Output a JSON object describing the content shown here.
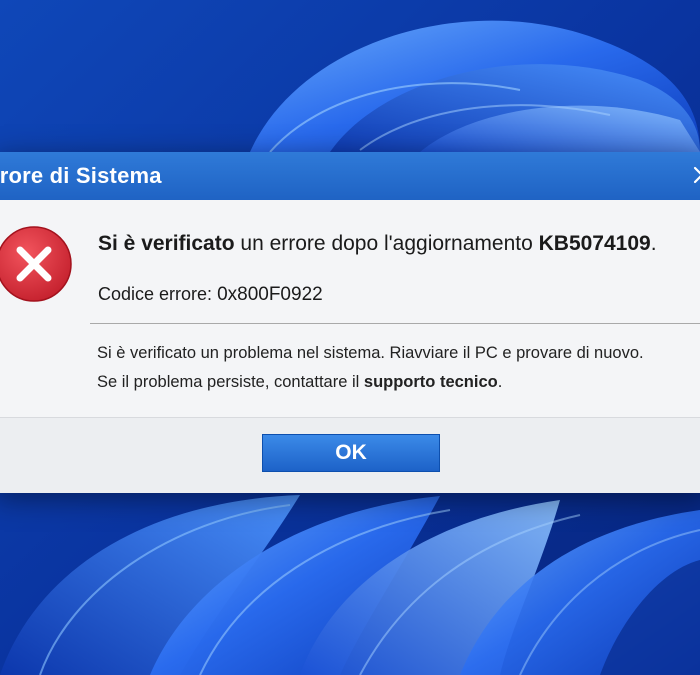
{
  "dialog": {
    "title": "rrore di Sistema",
    "close_icon": "close-icon",
    "error_icon": "error-x-icon",
    "headline": {
      "bold_lead": "Si è verificato",
      "middle": " un errore dopo l'aggiornamento ",
      "kb_number": "KB5074109",
      "end": "."
    },
    "error_code": {
      "label": "Codice errore: ",
      "value": "0x800F0922"
    },
    "message_line1": "Si è verificato un problema nel sistema. Riavviare il PC e provare di nuovo.",
    "message_line2": {
      "prefix": "Se il problema persiste, contattare il ",
      "link_text": "supporto tecnico",
      "suffix": "."
    },
    "ok_label": "OK"
  },
  "colors": {
    "titlebar": "#2a70d2",
    "error_red": "#d9333f",
    "wallpaper_blue": "#0b3aa8",
    "button_blue": "#2b74d8"
  }
}
